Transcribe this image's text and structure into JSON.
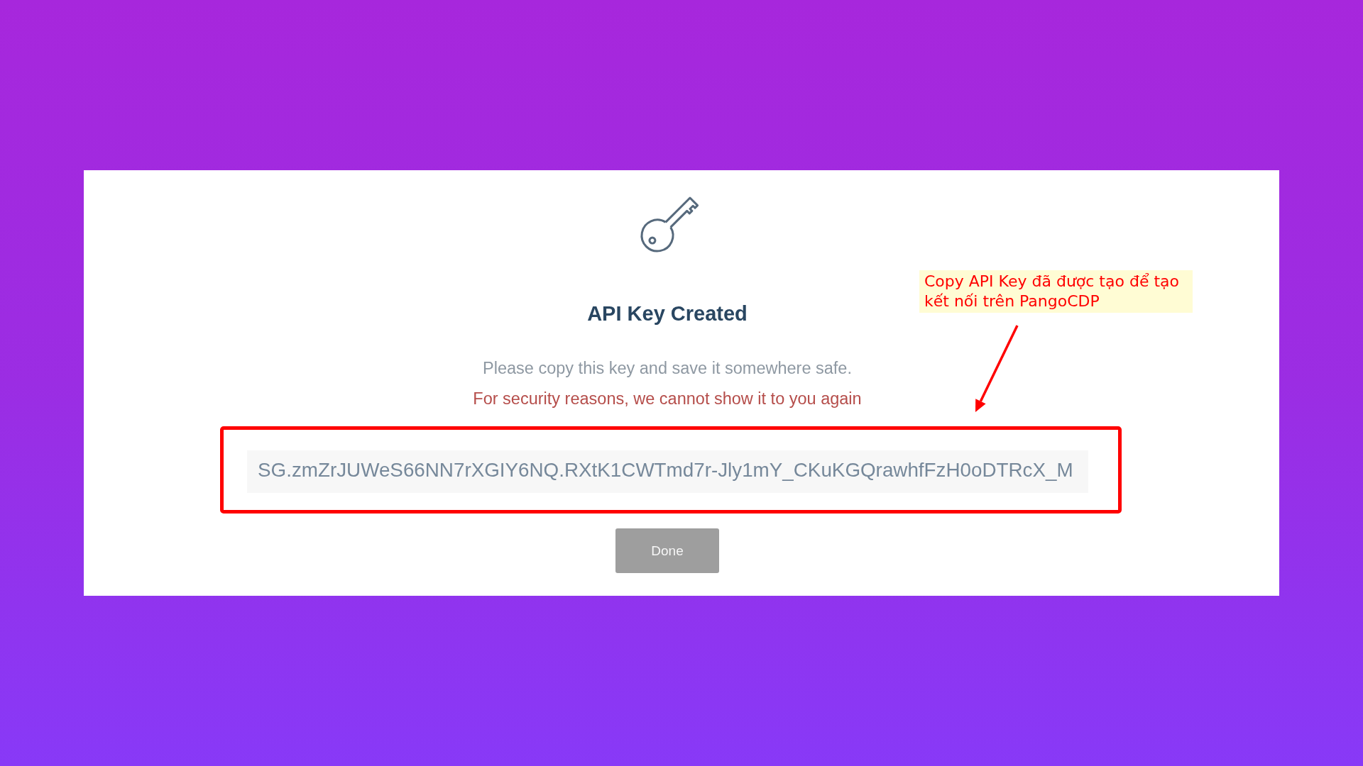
{
  "dialog": {
    "title": "API Key Created",
    "message": "Please copy this key and save it somewhere safe.",
    "warning": "For security reasons, we cannot show it to you again",
    "api_key": {
      "value": "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"
    },
    "buttons": [
      {
        "label": "Done"
      }
    ]
  },
  "annotation": {
    "note": "Copy API Key đã được tạo để tạo kết nối trên PangoCDP"
  }
}
